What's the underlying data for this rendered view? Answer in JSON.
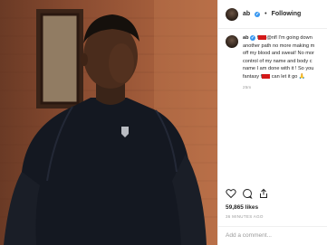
{
  "post": {
    "username": "ab",
    "verified_badge": "✓",
    "separator": "•",
    "follow_label": "Following",
    "caption": {
      "username": "ab",
      "line1_a": "f",
      "line1_b": "@nfl I'm going down",
      "line2": "another path no more making m",
      "line3": "off my blood and sweat! No mor",
      "line4": "control of my name and body c",
      "line5": "name I am done with it ! So you",
      "line6_a": "fantasy f",
      "line6_b": "can let it go",
      "emoji": "🙏",
      "timestamp": "25m"
    },
    "likes": "59,865 likes",
    "time_ago": "36 MINUTES AGO",
    "comment_placeholder": "Add a comment..."
  },
  "icons": {
    "like": "heart-icon",
    "comment": "comment-icon",
    "share": "share-icon",
    "verified": "verified-badge-icon"
  },
  "colors": {
    "verified": "#3897f0",
    "redaction": "#d31919",
    "text": "#262626",
    "muted": "#999999"
  }
}
